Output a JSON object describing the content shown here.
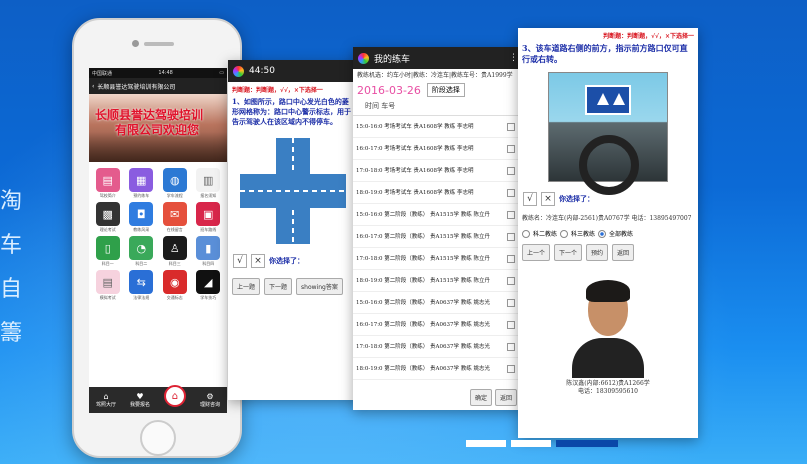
{
  "side_text": [
    "淘",
    "车",
    "自",
    "籌"
  ],
  "phone": {
    "status_left": "中国联通",
    "status_time": "14:48",
    "title": "长顺县誉达驾驶培训有限公司",
    "banner_line1": "长顺县誉达驾驶培训",
    "banner_line2": "有限公司欢迎您",
    "grid_icons": [
      {
        "icon": "pink-card-icon",
        "color": "#e45b8d",
        "glyph": "▤",
        "label": "驾校简介"
      },
      {
        "icon": "calendar-icon",
        "color": "#8a5ce0",
        "glyph": "▦",
        "label": "预约练车"
      },
      {
        "icon": "globe-icon",
        "color": "#2c79d4",
        "glyph": "◍",
        "label": "学车流程"
      },
      {
        "icon": "document-icon",
        "color": "#f2f2f2",
        "glyph": "▥",
        "label": "报名须知"
      },
      {
        "icon": "keypad-icon",
        "color": "#333333",
        "glyph": "▩",
        "label": "理论考试"
      },
      {
        "icon": "car-icon",
        "color": "#2f7ce0",
        "glyph": "◘",
        "label": "教练风采"
      },
      {
        "icon": "envelope-icon",
        "color": "#e5503c",
        "glyph": "✉",
        "label": "在线留言"
      },
      {
        "icon": "bus-icon",
        "color": "#d8264a",
        "glyph": "▣",
        "label": "班车路线"
      },
      {
        "icon": "notebook-icon",
        "color": "#2fa04a",
        "glyph": "▯",
        "label": "科目一"
      },
      {
        "icon": "clock-icon",
        "color": "#3aa95a",
        "glyph": "◔",
        "label": "科目二"
      },
      {
        "icon": "person-icon",
        "color": "#1b1b1b",
        "glyph": "♙",
        "label": "科目三"
      },
      {
        "icon": "bottle-icon",
        "color": "#5a8fd8",
        "glyph": "▮",
        "label": "科目四"
      },
      {
        "icon": "doc-pink-icon",
        "color": "#f6d2de",
        "glyph": "▤",
        "label": "模拟考试"
      },
      {
        "icon": "arrows-icon",
        "color": "#2a6fd6",
        "glyph": "⇆",
        "label": "法律法规"
      },
      {
        "icon": "speed-sign-icon",
        "color": "#d92b2b",
        "glyph": "◉",
        "label": "交通标志"
      },
      {
        "icon": "road-icon",
        "color": "#111111",
        "glyph": "◢",
        "label": "学车技巧"
      }
    ],
    "tabs": [
      {
        "label": "驾照大厅",
        "icon": "home-icon"
      },
      {
        "label": "我要报名",
        "icon": "heart-icon"
      },
      {
        "label": "",
        "icon": "house-icon"
      },
      {
        "label": "理财咨询",
        "icon": "settings-icon"
      }
    ]
  },
  "screen1": {
    "time": "44:50",
    "question": "1、如图所示，路口中心发光白色的菱形网格称为：路口中心警示标志，用于告示驾驶人在该区域内不得停车。",
    "answer_prefix": "判断题：判断题，√√，×下选择一",
    "your_choice": "你选择了：",
    "buttons": [
      "上一题",
      "下一题",
      "showing答案"
    ],
    "choices": [
      "√",
      "×"
    ]
  },
  "screen2": {
    "app_title": "我的练车",
    "info": "教练机选：约车小时|教练：冷连车|教练车号：贵A1999学",
    "date": "2016-03-26",
    "phase": "阶段选择",
    "table_head": "时间 车号",
    "slots": [
      "15:0-16:0 考场考试车 贵A1608学 教练 李志明",
      "16:0-17:0 考场考试车 贵A1608学 教练 李志明",
      "17:0-18:0 考场考试车 贵A1608学 教练 李志明",
      "18:0-19:0 考场考试车 贵A1608学 教练 李志明",
      "15:0-16:0 第二阶段（教练） 贵A1515学 教练 陈立丹",
      "16:0-17:0 第二阶段（教练） 贵A1515学 教练 陈立丹",
      "17:0-18:0 第二阶段（教练） 贵A1515学 教练 陈立丹",
      "18:0-19:0 第二阶段（教练） 贵A1515学 教练 陈立丹",
      "15:0-16:0 第二阶段（教练） 贵A0637学 教练 姚志光",
      "16:0-17:0 第二阶段（教练） 贵A0637学 教练 姚志光",
      "17:0-18:0 第二阶段（教练） 贵A0637学 教练 姚志光",
      "18:0-19:0 第二阶段（教练） 贵A0637学 教练 姚志光"
    ],
    "btn_confirm": "确定",
    "btn_cancel": "返回"
  },
  "screen3": {
    "answer_prefix": "判断题：判断题，√√，×下选择一",
    "question": "3、该车道路右侧的前方，指示前方路口仅可直行或右转。",
    "choices": [
      "√",
      "×"
    ],
    "your_choice": "你选择了：",
    "coach_info": "教练名：冷连车(内部-2561)贵A0767学 电话：13895497007",
    "radios": [
      "科二教练",
      "科三教练",
      "全部教练"
    ],
    "radio_selected": 2,
    "buttons": [
      "上一个",
      "下一个",
      "预约",
      "返回"
    ],
    "caption_line1": "陈汉鑫(内部:6612)贵A1266学",
    "caption_line2": "电话：18309595610"
  }
}
